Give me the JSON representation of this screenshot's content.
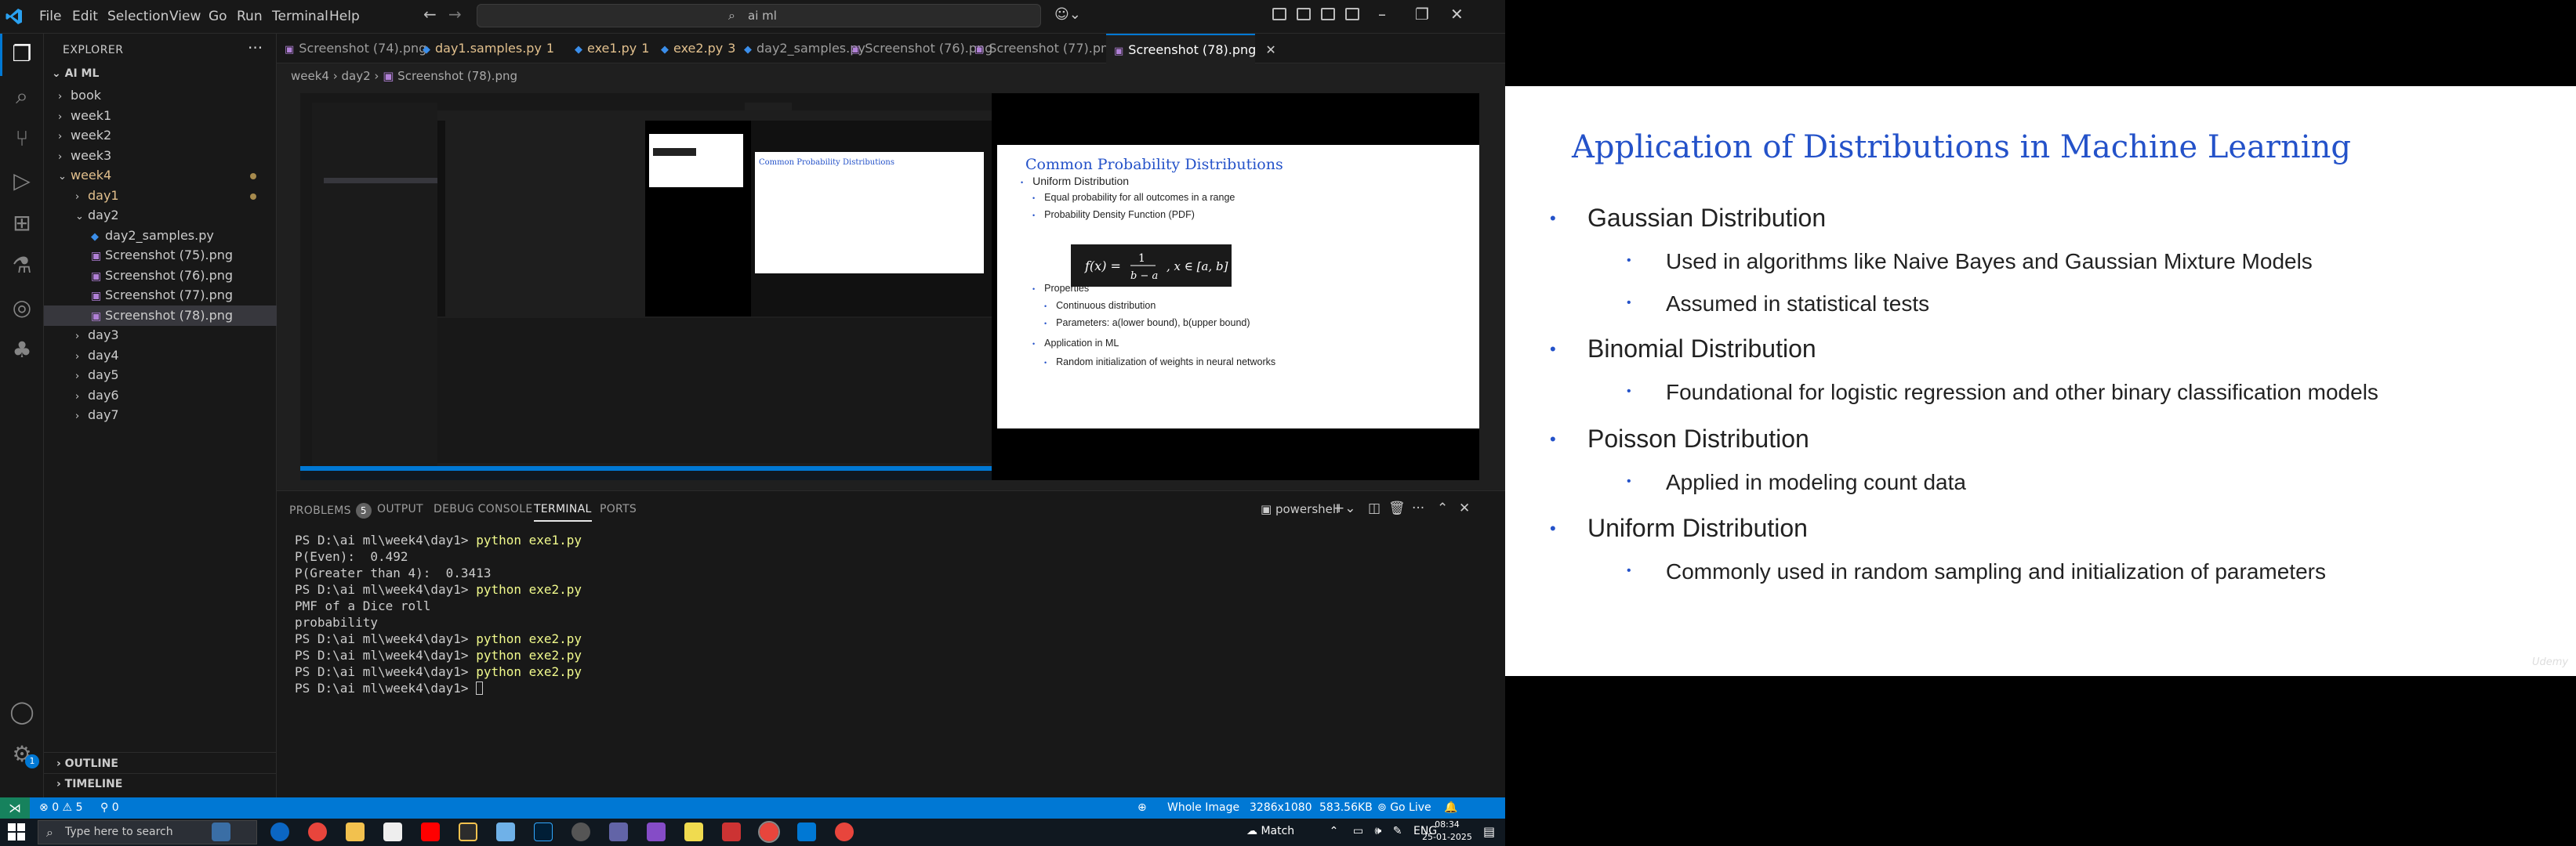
{
  "menu": [
    "File",
    "Edit",
    "Selection",
    "View",
    "Go",
    "Run",
    "Terminal",
    "Help"
  ],
  "command_center": "ai ml",
  "sidebar": {
    "title": "EXPLORER",
    "root": "AI ML",
    "items": [
      {
        "label": "book",
        "type": "folder",
        "open": false,
        "depth": 1
      },
      {
        "label": "week1",
        "type": "folder",
        "open": false,
        "depth": 1
      },
      {
        "label": "week2",
        "type": "folder",
        "open": false,
        "depth": 1
      },
      {
        "label": "week3",
        "type": "folder",
        "open": false,
        "depth": 1
      },
      {
        "label": "week4",
        "type": "folder",
        "open": true,
        "depth": 1,
        "modified": true
      },
      {
        "label": "day1",
        "type": "folder",
        "open": false,
        "depth": 2,
        "modified": true
      },
      {
        "label": "day2",
        "type": "folder",
        "open": true,
        "depth": 2
      },
      {
        "label": "day2_samples.py",
        "type": "py",
        "depth": 3
      },
      {
        "label": "Screenshot (75).png",
        "type": "png",
        "depth": 3
      },
      {
        "label": "Screenshot (76).png",
        "type": "png",
        "depth": 3
      },
      {
        "label": "Screenshot (77).png",
        "type": "png",
        "depth": 3
      },
      {
        "label": "Screenshot (78).png",
        "type": "png",
        "depth": 3,
        "selected": true
      },
      {
        "label": "day3",
        "type": "folder",
        "open": false,
        "depth": 2
      },
      {
        "label": "day4",
        "type": "folder",
        "open": false,
        "depth": 2
      },
      {
        "label": "day5",
        "type": "folder",
        "open": false,
        "depth": 2
      },
      {
        "label": "day6",
        "type": "folder",
        "open": false,
        "depth": 2
      },
      {
        "label": "day7",
        "type": "folder",
        "open": false,
        "depth": 2
      }
    ],
    "outline": "OUTLINE",
    "timeline": "TIMELINE"
  },
  "tabs": [
    {
      "label": "Screenshot (74).png",
      "type": "png"
    },
    {
      "label": "day1.samples.py",
      "type": "py",
      "badge": "1",
      "modified": true
    },
    {
      "label": "exe1.py",
      "type": "py",
      "badge": "1",
      "modified": true
    },
    {
      "label": "exe2.py",
      "type": "py",
      "badge": "3",
      "modified": true
    },
    {
      "label": "day2_samples.py",
      "type": "py"
    },
    {
      "label": "Screenshot (76).png",
      "type": "png"
    },
    {
      "label": "Screenshot (77).png",
      "type": "png"
    },
    {
      "label": "Screenshot (78).png",
      "type": "png",
      "active": true
    }
  ],
  "breadcrumb": [
    "week4",
    "day2",
    "Screenshot (78).png"
  ],
  "preview_slide": {
    "title": "Common Probability Distributions",
    "items": [
      {
        "level": 1,
        "text": "Uniform Distribution"
      },
      {
        "level": 2,
        "text": "Equal probability for all outcomes in a range"
      },
      {
        "level": 2,
        "text": "Probability Density Function (PDF)"
      },
      {
        "level": 2,
        "text": "Properties"
      },
      {
        "level": 3,
        "text": "Continuous distribution"
      },
      {
        "level": 3,
        "text": "Parameters: a(lower bound), b(upper bound)"
      },
      {
        "level": 2,
        "text": "Application in ML"
      },
      {
        "level": 3,
        "text": "Random initialization of weights in neural networks"
      }
    ]
  },
  "panel": {
    "tabs": [
      {
        "label": "PROBLEMS",
        "count": "5"
      },
      {
        "label": "OUTPUT"
      },
      {
        "label": "DEBUG CONSOLE"
      },
      {
        "label": "TERMINAL",
        "active": true
      },
      {
        "label": "PORTS"
      }
    ],
    "shell": "powershell",
    "terminal": [
      {
        "prompt": "PS D:\\ai ml\\week4\\day1> ",
        "cmd": "python exe1.py"
      },
      {
        "text": "P(Even):  0.492"
      },
      {
        "text": "P(Greater than 4):  0.3413"
      },
      {
        "prompt": "PS D:\\ai ml\\week4\\day1> ",
        "cmd": "python exe2.py"
      },
      {
        "text": "PMF of a Dice roll"
      },
      {
        "text": "probability"
      },
      {
        "prompt": "PS D:\\ai ml\\week4\\day1> ",
        "cmd": "python exe2.py"
      },
      {
        "prompt": "PS D:\\ai ml\\week4\\day1> ",
        "cmd": "python exe2.py"
      },
      {
        "prompt": "PS D:\\ai ml\\week4\\day1> ",
        "cmd": "python exe2.py"
      },
      {
        "prompt": "PS D:\\ai ml\\week4\\day1> ",
        "cursor": true
      }
    ]
  },
  "status": {
    "errors": "0",
    "warnings": "5",
    "ports": "0",
    "mode": "Whole Image",
    "dims": "3286x1080",
    "size": "583.56KB",
    "golive": "Go Live"
  },
  "taskbar": {
    "search_placeholder": "Type here to search",
    "weather": "Match",
    "lang": "ENG",
    "time": "08:34",
    "date": "25-01-2025"
  },
  "slide": {
    "title": "Application of Distributions in Machine Learning",
    "bullets": [
      {
        "level": 1,
        "text": "Gaussian Distribution"
      },
      {
        "level": 2,
        "text": "Used in algorithms like Naive Bayes and Gaussian Mixture Models"
      },
      {
        "level": 2,
        "text": "Assumed in statistical tests"
      },
      {
        "level": 1,
        "text": "Binomial Distribution"
      },
      {
        "level": 2,
        "text": "Foundational for logistic regression and other binary classification models"
      },
      {
        "level": 1,
        "text": "Poisson Distribution"
      },
      {
        "level": 2,
        "text": "Applied in modeling count data"
      },
      {
        "level": 1,
        "text": "Uniform Distribution"
      },
      {
        "level": 2,
        "text": "Commonly used in random sampling and initialization of parameters"
      }
    ],
    "colors": {
      "title": "#2452c9",
      "bullet": "#2452c9"
    }
  }
}
